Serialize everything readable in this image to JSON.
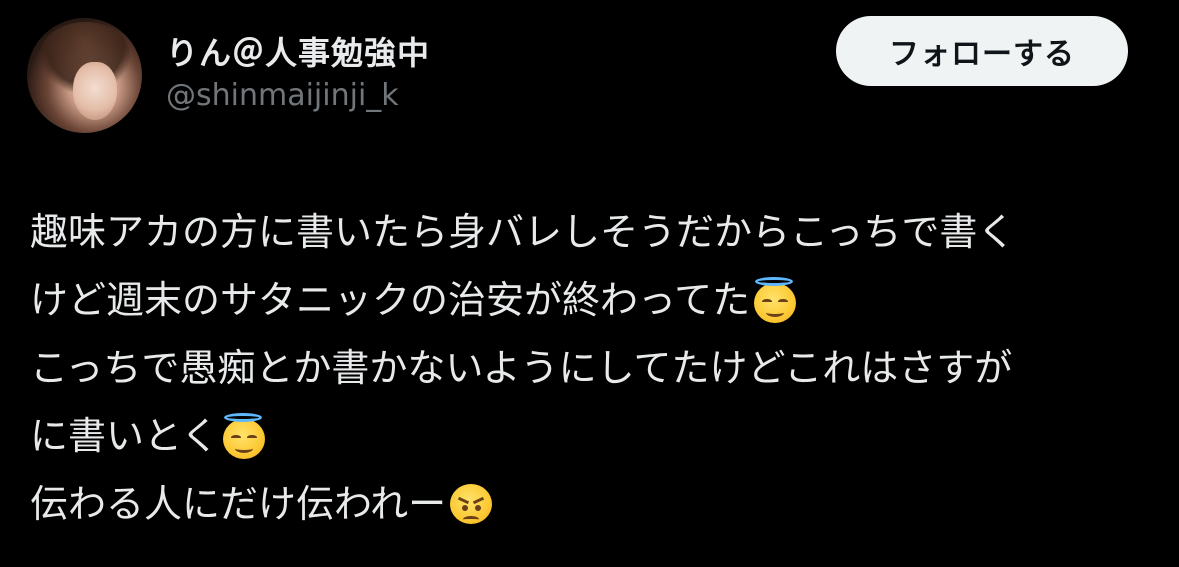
{
  "user": {
    "display_name": "りん＠人事勉強中",
    "handle": "@shinmaijinji_k"
  },
  "follow_button": {
    "label": "フォローする"
  },
  "tweet": {
    "line1": "趣味アカの方に書いたら身バレしそうだからこっちで書く",
    "line2": "けど週末のサタニックの治安が終わってた",
    "line3": "こっちで愚痴とか書かないようにしてたけどこれはさすが",
    "line4": "に書いとく",
    "line5": "伝わる人にだけ伝われー",
    "emojis": [
      "smiling-face-with-halo",
      "smiling-face-with-halo",
      "angry-face"
    ]
  },
  "colors": {
    "background": "#000000",
    "text": "#e7e9ea",
    "secondary_text": "#71767b",
    "button_bg": "#eff3f4",
    "button_text": "#0f1419"
  }
}
